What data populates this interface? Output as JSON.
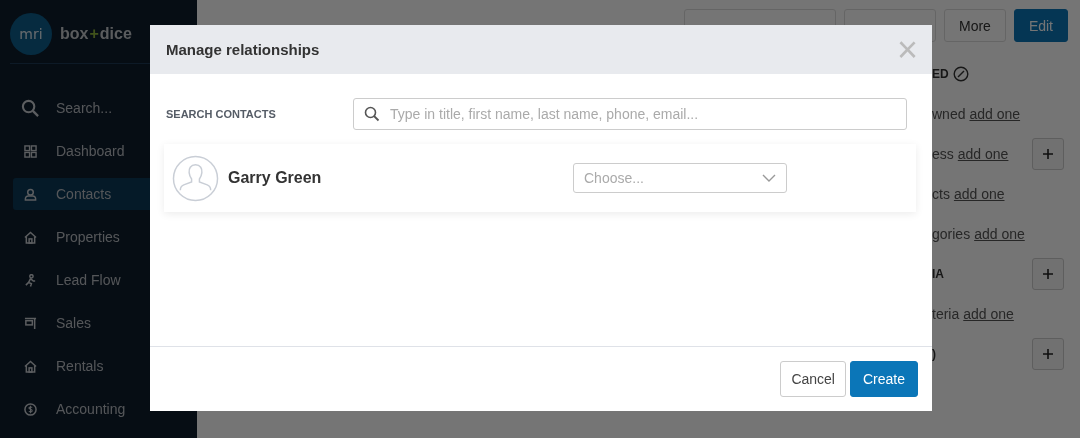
{
  "sidebar": {
    "brand": {
      "logo_text": "mri",
      "name_left": "box",
      "name_plus": "+",
      "name_right": "dice"
    },
    "items": [
      {
        "label": "Search...",
        "selected": false
      },
      {
        "label": "Dashboard",
        "selected": false
      },
      {
        "label": "Contacts",
        "selected": true
      },
      {
        "label": "Properties",
        "selected": false
      },
      {
        "label": "Lead Flow",
        "selected": false
      },
      {
        "label": "Sales",
        "selected": false
      },
      {
        "label": "Rentals",
        "selected": false
      },
      {
        "label": "Accounting",
        "selected": false
      }
    ]
  },
  "page": {
    "actions": [
      {
        "label": "More",
        "kind": "plain"
      },
      {
        "label": "Edit",
        "kind": "primary"
      }
    ],
    "side_rows": [
      {
        "kind": "heading",
        "text": "ED",
        "plus": false
      },
      {
        "kind": "text",
        "text": "wned",
        "link": "add one",
        "plus": false
      },
      {
        "kind": "text",
        "text": "ess",
        "link": "add one",
        "plus": true
      },
      {
        "kind": "text",
        "text": "cts",
        "link": "add one",
        "plus": false
      },
      {
        "kind": "text",
        "text": "gories",
        "link": "add one",
        "plus": false
      },
      {
        "kind": "heading",
        "text": "IA",
        "plus": true
      },
      {
        "kind": "text",
        "text": "teria",
        "link": "add one",
        "plus": false
      },
      {
        "kind": "heading",
        "text": ")",
        "plus": true
      }
    ]
  },
  "modal": {
    "title": "Manage relationships",
    "close": "×",
    "search_label": "SEARCH CONTACTS",
    "search_placeholder": "Type in title, first name, last name, phone, email...",
    "contacts": [
      {
        "name": "Garry Green",
        "relationship_placeholder": "Choose..."
      }
    ],
    "buttons": [
      {
        "label": "Cancel",
        "kind": "secondary"
      },
      {
        "label": "Create",
        "kind": "primary"
      }
    ]
  }
}
